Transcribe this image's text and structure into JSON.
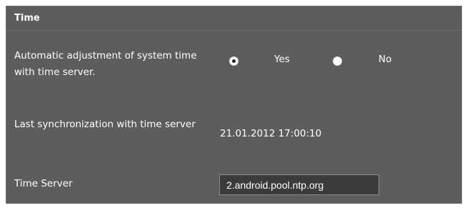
{
  "section": {
    "title": "Time"
  },
  "auto_adjust": {
    "label": "Automatic adjustment of system time with time server.",
    "options": [
      {
        "label": "Yes",
        "selected": true
      },
      {
        "label": "No",
        "selected": false
      }
    ]
  },
  "last_sync": {
    "label": "Last synchronization with time server",
    "value": "21.01.2012 17:00:10"
  },
  "time_server": {
    "label": "Time Server",
    "value": "2.android.pool.ntp.org"
  }
}
